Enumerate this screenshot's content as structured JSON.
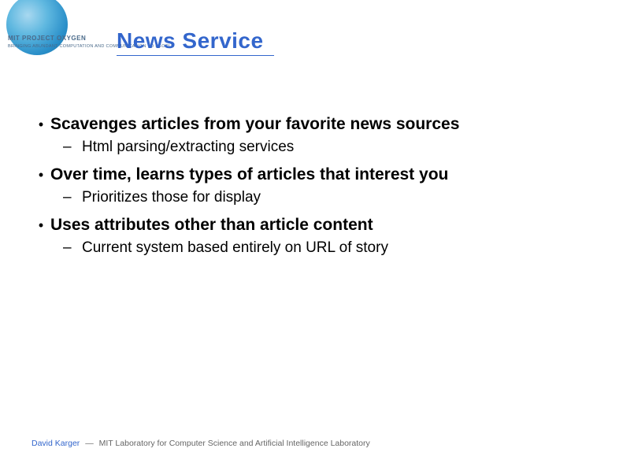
{
  "logo": {
    "line1": "MIT PROJECT OXYGEN",
    "line2": "BRINGING ABUNDANT COMPUTATION AND COMMUNICATION TO PEOPLE"
  },
  "title": "News Service",
  "bullets": [
    {
      "main": "Scavenges articles from your favorite news sources",
      "sub": "Html parsing/extracting services"
    },
    {
      "main": "Over time, learns types of articles that interest you",
      "sub": "Prioritizes those for display"
    },
    {
      "main": "Uses attributes other than article content",
      "sub": "Current system based entirely on URL of story"
    }
  ],
  "footer": {
    "author": "David Karger",
    "separator": "—",
    "affiliation": "MIT Laboratory for Computer Science and Artificial Intelligence Laboratory"
  }
}
